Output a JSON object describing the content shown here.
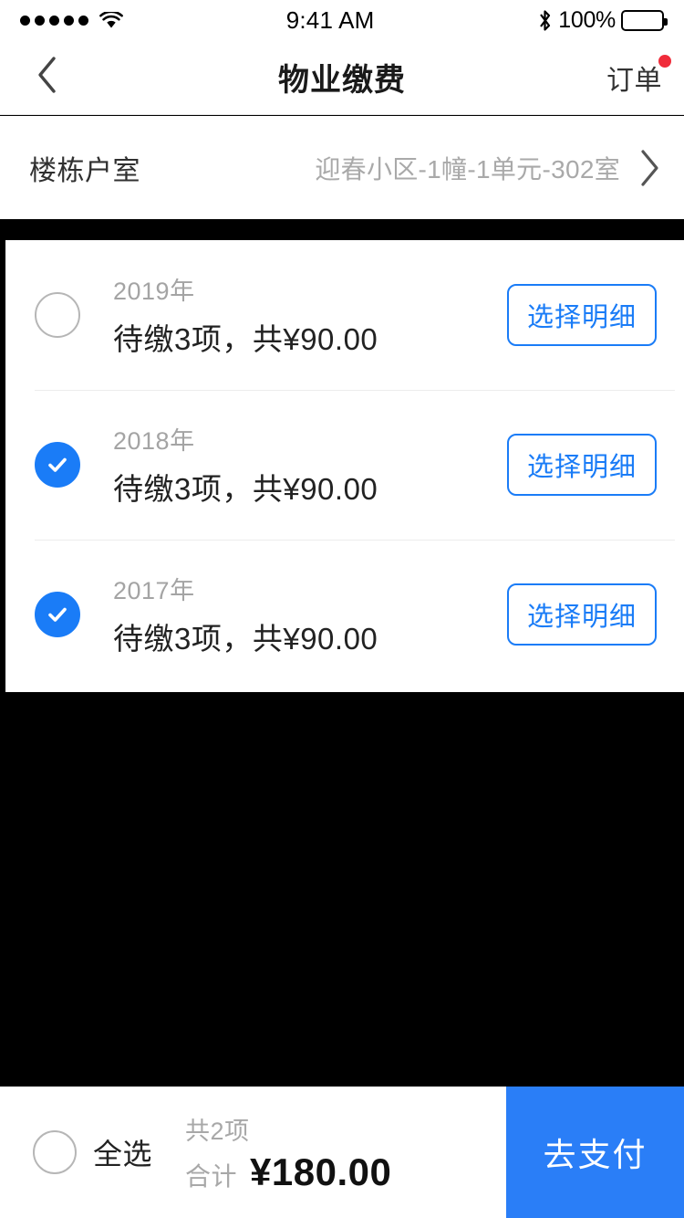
{
  "status_bar": {
    "signal_icon": "signal-dots-icon",
    "wifi_icon": "wifi-icon",
    "time": "9:41 AM",
    "bluetooth_icon": "bluetooth-icon",
    "battery_percent": "100%",
    "battery_icon": "battery-full-icon"
  },
  "nav": {
    "back_icon": "chevron-left-icon",
    "title": "物业缴费",
    "action_label": "订单",
    "badge_icon": "red-dot-badge-icon"
  },
  "address": {
    "label": "楼栋户室",
    "value": "迎春小区-1幢-1单元-302室",
    "chevron_icon": "chevron-right-icon"
  },
  "bills": [
    {
      "year": "2019年",
      "description": "待缴3项，共¥90.00",
      "detail_button": "选择明细",
      "checked": false,
      "check_icon": "circle-outline-icon"
    },
    {
      "year": "2018年",
      "description": "待缴3项，共¥90.00",
      "detail_button": "选择明细",
      "checked": true,
      "check_icon": "check-circle-filled-icon"
    },
    {
      "year": "2017年",
      "description": "待缴3项，共¥90.00",
      "detail_button": "选择明细",
      "checked": true,
      "check_icon": "check-circle-filled-icon"
    }
  ],
  "footer": {
    "select_all_label": "全选",
    "select_all_checked": false,
    "select_all_icon": "circle-outline-icon",
    "count_text": "共2项",
    "total_label": "合计",
    "total_amount": "¥180.00",
    "pay_button": "去支付"
  },
  "colors": {
    "accent_blue": "#1a7cf7",
    "pay_blue": "#2a7ef7",
    "badge_red": "#f02c3a",
    "muted_gray": "#a8a8a8",
    "backdrop": "#000000"
  }
}
